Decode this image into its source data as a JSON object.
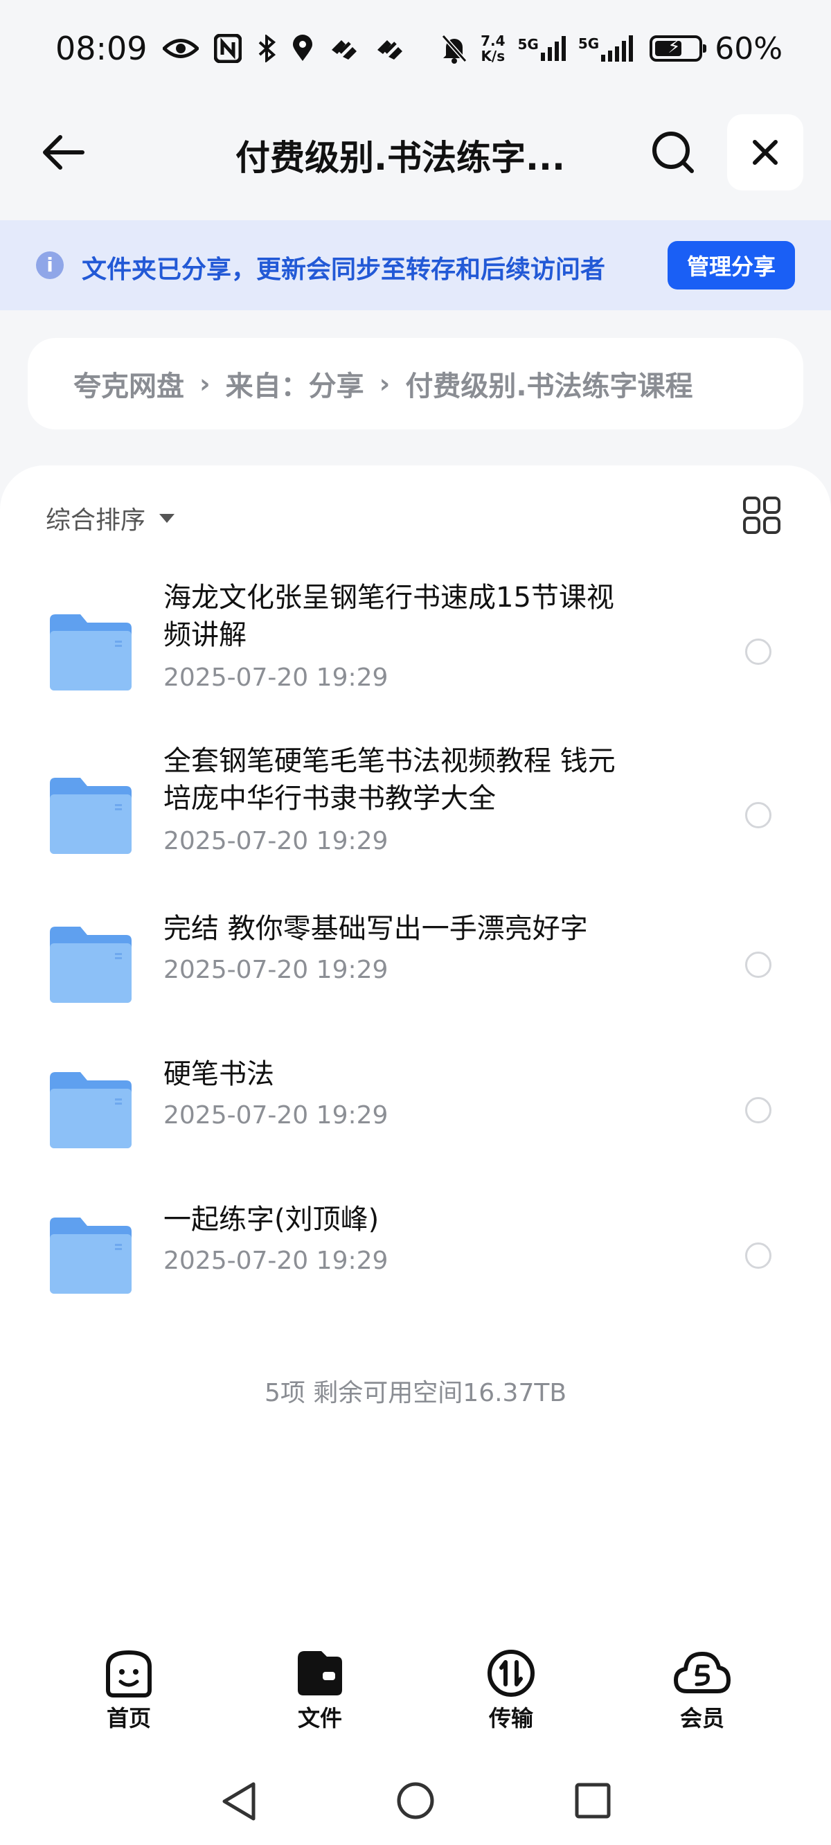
{
  "status_bar": {
    "time": "08:09",
    "net_speed_value": "7.4",
    "net_speed_unit": "K/s",
    "sim1_label": "5G",
    "sim2_label": "5G",
    "battery": "60%"
  },
  "header": {
    "title": "付费级别.书法练字..."
  },
  "banner": {
    "text": "文件夹已分享，更新会同步至转存和后续访问者",
    "manage_button": "管理分享"
  },
  "breadcrumb": {
    "items": [
      "夸克网盘",
      "来自：分享",
      "付费级别.书法练字课程"
    ]
  },
  "toolbar": {
    "sort_label": "综合排序"
  },
  "files": [
    {
      "name_line1": "海龙文化张呈钢笔行书速成15节课视",
      "name_line2": "频讲解",
      "date": "2025-07-20 19:29"
    },
    {
      "name_line1": "全套钢笔硬笔毛笔书法视频教程 钱元",
      "name_line2": "培庞中华行书隶书教学大全",
      "date": "2025-07-20 19:29"
    },
    {
      "name_line1": "完结 教你零基础写出一手漂亮好字",
      "name_line2": "",
      "date": "2025-07-20 19:29"
    },
    {
      "name_line1": "硬笔书法",
      "name_line2": "",
      "date": "2025-07-20 19:29"
    },
    {
      "name_line1": "一起练字(刘顶峰)",
      "name_line2": "",
      "date": "2025-07-20 19:29"
    }
  ],
  "footer": {
    "summary": "5项 剩余可用空间16.37TB"
  },
  "bottom_nav": {
    "home": "首页",
    "files": "文件",
    "transfer": "传输",
    "member": "会员"
  },
  "colors": {
    "accent": "#1a5ff5",
    "banner_bg": "#e4eafb",
    "banner_text": "#2259d6",
    "folder": "#7fb5f5"
  }
}
